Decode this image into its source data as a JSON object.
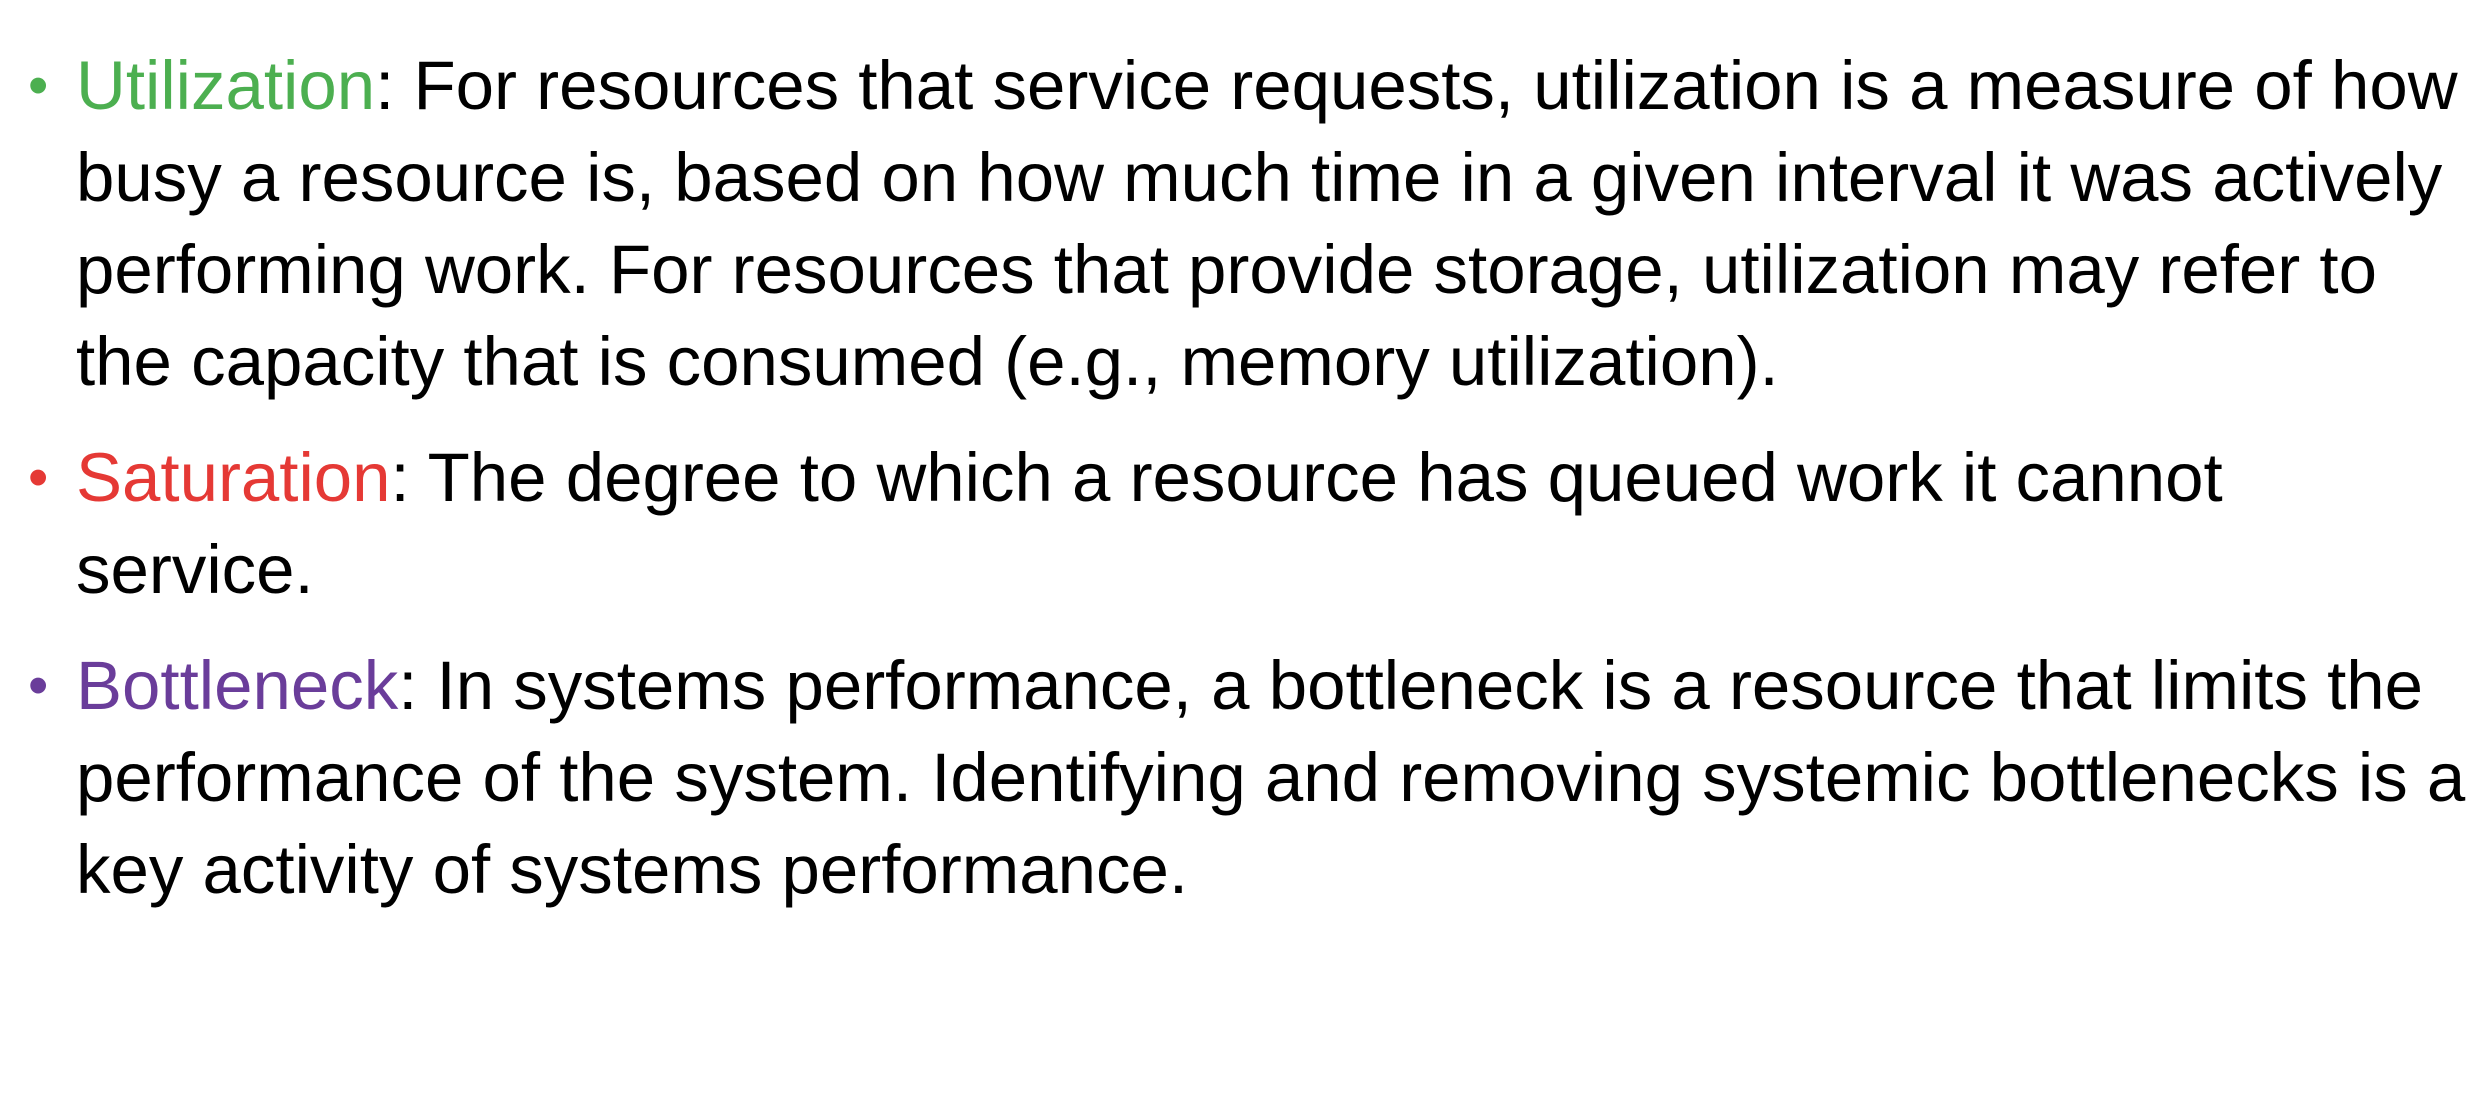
{
  "colors": {
    "utilization": "#4CAF50",
    "saturation": "#E53935",
    "bottleneck": "#6A3D9A",
    "text": "#000000"
  },
  "bullet_glyph": "•",
  "items": [
    {
      "term": "Utilization",
      "separator": ":",
      "definition": " For resources that service requests, utilization is a measure of how busy a resource is, based on how much time in a given interval it was actively performing work. For resources that provide storage, utilization may refer to the capacity that is consumed (e.g., memory utilization)."
    },
    {
      "term": "Saturation",
      "separator": ":",
      "definition": " The degree to which a resource has queued work it cannot service."
    },
    {
      "term": "Bottleneck",
      "separator": ":",
      "definition": " In systems performance, a bottleneck is a resource that limits the performance of the system. Identifying and removing systemic bottlenecks is a key activity of systems performance."
    }
  ]
}
